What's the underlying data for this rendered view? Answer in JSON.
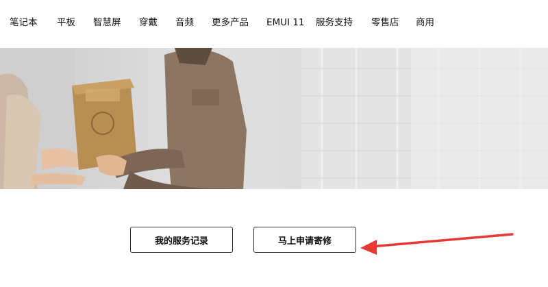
{
  "nav": {
    "items": [
      {
        "label": "笔记本"
      },
      {
        "label": "平板"
      },
      {
        "label": "智慧屏"
      },
      {
        "label": "穿戴"
      },
      {
        "label": "音频"
      },
      {
        "label": "更多产品"
      },
      {
        "label": "EMUI 11"
      },
      {
        "label": "服务支持"
      },
      {
        "label": "零售店"
      },
      {
        "label": "商用"
      }
    ]
  },
  "hero": {
    "image": "courier-handing-package-photo"
  },
  "actions": {
    "service_records_label": "我的服务记录",
    "mail_repair_label": "马上申请寄修"
  },
  "annotation": {
    "arrow_color": "#e53935"
  }
}
